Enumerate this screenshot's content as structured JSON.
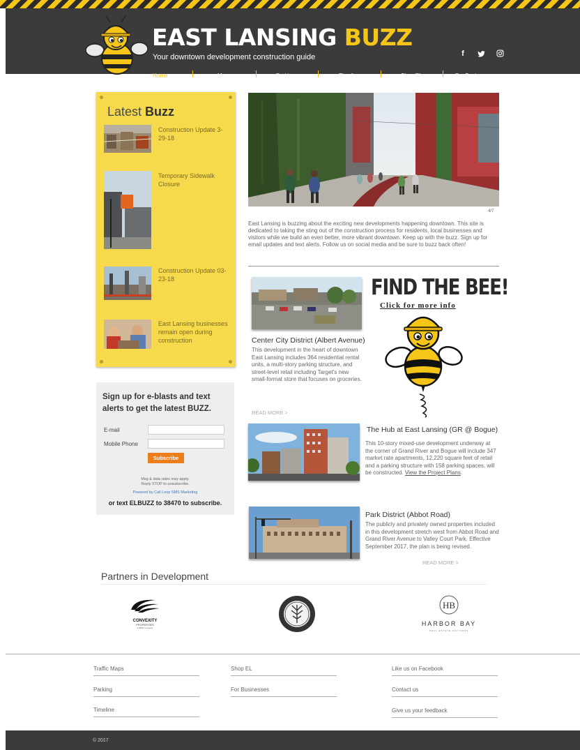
{
  "header": {
    "title_main": "EAST LANSING ",
    "title_accent": "BUZZ",
    "tagline": "Your downtown development construction guide",
    "social": [
      {
        "icon": "facebook-icon",
        "glyph": "f"
      },
      {
        "icon": "twitter-icon",
        "glyph": "t"
      },
      {
        "icon": "instagram-icon",
        "glyph": "◎"
      }
    ],
    "nav": [
      "Home",
      "Maps",
      "Parking",
      "Timeline",
      "Shop EL",
      "For Businesses"
    ],
    "colors": {
      "bar": "#3b3b3b",
      "accent": "#f5c518"
    }
  },
  "sidebar": {
    "title_light": "Latest ",
    "title_bold": "Buzz",
    "items": [
      {
        "text": "Construction Update 3-29-18"
      },
      {
        "text": "Temporary Sidewalk Closure"
      },
      {
        "text": "Construction Update 03-23-18"
      },
      {
        "text": "East Lansing businesses remain open during construction"
      }
    ]
  },
  "signup": {
    "heading": "Sign up for e-blasts and text alerts to get the latest BUZZ.",
    "email_label": "E-mail",
    "phone_label": "Mobile Phone",
    "email_value": "",
    "phone_value": "",
    "button": "Subscribe",
    "fine1": "Msg & data rates may apply.",
    "fine2": "Reply STOP to unsubscribe.",
    "powered": "Powered by Call Loop SMS Marketing",
    "text_sub": "or text ELBUZZ to 38470 to subscribe."
  },
  "hero": {
    "counter": "4/7",
    "intro": "East Lansing is buzzing about the exciting new developments happening downtown. This site is dedicated to taking the sting out of the construction process for residents, local businesses and visitors while we build an even better, more vibrant downtown. Keep up with the buzz. Sign up for email updates and text alerts. Follow us on social media and be sure to buzz back often!"
  },
  "find_bee": {
    "headline": "FIND THE BEE!",
    "link": "Click for more info"
  },
  "cards": [
    {
      "title": "Center City District (Albert Avenue)",
      "body": "This development in the heart of downtown East Lansing includes 364 residential rental units, a multi-story parking structure, and street-level retail including Target's new small-format store that focuses on groceries.",
      "read_more": "READ MORE >"
    },
    {
      "title": "The Hub at East Lansing (GR @ Bogue)",
      "body": "This 10-story mixed-use development underway at the corner of Grand River and Bogue will include 347 market rate apartments, 12,220 square feet of retail and a parking structure with 158 parking spaces, will be constructed. ",
      "link": "View the Project Plans",
      "after_link": "."
    },
    {
      "title": "Park District (Abbot Road)",
      "body": "The publicly and privately owned properties included in this development stretch west from Abbot Road and Grand River Avenue to Valley Court Park. Effective September 2017, the plan is being revised.",
      "read_more": "READ MORE >"
    }
  ],
  "partners": {
    "title": "Partners in Development",
    "logos": [
      {
        "name": "CONVEXITY",
        "sub": "PROPERTIES",
        "tiny": "a DBW company"
      },
      {
        "name": "CITY OF EAST LANSING",
        "sub": "MICHIGAN"
      },
      {
        "name": "HARBOR BAY",
        "mark": "HB",
        "sub": "REAL ESTATE ADVISORS"
      }
    ]
  },
  "footer": {
    "col1": [
      "Traffic Maps",
      "Parking",
      "Timeline"
    ],
    "col2": [
      "Shop EL",
      "For Businesses"
    ],
    "col3": [
      "Like us on Facebook",
      "Contact us",
      "Give us your feedback"
    ],
    "copyright": "© 2017"
  }
}
